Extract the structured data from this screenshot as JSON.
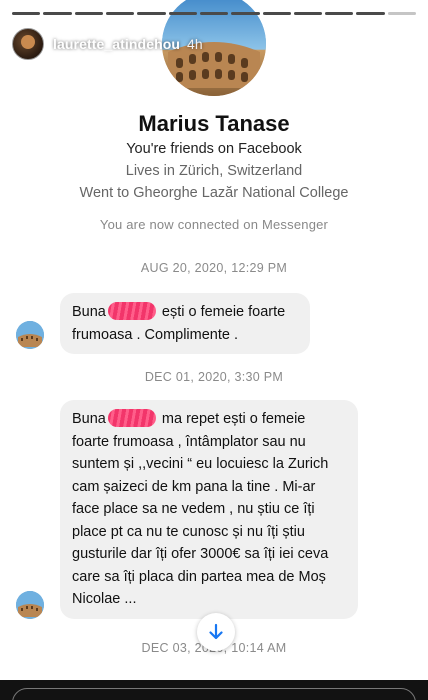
{
  "story": {
    "username": "laurette_atindehou",
    "time_ago": "4h",
    "progress_segments": 13,
    "progress_done": 12,
    "icons": [
      "play-icon",
      "mute-icon",
      "more-icon"
    ]
  },
  "profile": {
    "name": "Marius Tanase",
    "friends_line": "You're friends on Facebook",
    "lives_line": "Lives in Zürich, Switzerland",
    "school_line": "Went to Gheorghe Lazăr National College",
    "connected_note": "You are now connected on Messenger"
  },
  "conversation": [
    {
      "date": "AUG 20, 2020, 12:29 PM",
      "message_before": "Buna",
      "message_after": " ești o femeie foarte frumoasa . Complimente ."
    },
    {
      "date": "DEC 01, 2020, 3:30 PM",
      "message_before": "Buna",
      "message_after": " ma repet ești o femeie foarte frumoasa , întâmplator sau nu suntem și ,,vecini “ eu locuiesc la Zurich cam șaizeci de km pana la tine . Mi-ar face place sa ne vedem , nu știu ce îți place pt ca nu te cunosc și nu îți știu gusturile dar îți ofer 3000€ sa îți iei ceva care sa îți placa din partea mea de Moș Nicolae ..."
    },
    {
      "date": "DEC 03, 2020, 10:14 AM"
    }
  ],
  "colors": {
    "bubble": "#f0f0f0",
    "redaction": "#f2356a",
    "scroll_arrow": "#1877f2"
  }
}
